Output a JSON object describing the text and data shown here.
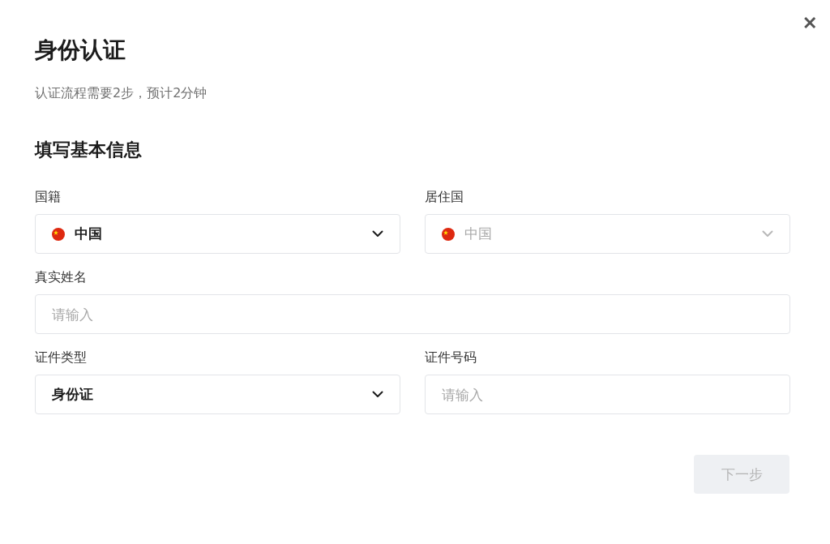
{
  "dialog": {
    "title": "身份认证",
    "close": "✕",
    "subtitle": "认证流程需要2步，预计2分钟"
  },
  "section": {
    "title": "填写基本信息"
  },
  "rows": [
    [
      {
        "kind": "select",
        "label": "国籍",
        "value": "中国",
        "flag": true,
        "disabled": false
      },
      {
        "kind": "select",
        "label": "居住国",
        "value": "中国",
        "flag": true,
        "disabled": true
      }
    ],
    [
      {
        "kind": "input",
        "label": "真实姓名",
        "placeholder": "请输入"
      }
    ],
    [
      {
        "kind": "select",
        "label": "证件类型",
        "value": "身份证",
        "flag": false,
        "disabled": false
      },
      {
        "kind": "input",
        "label": "证件号码",
        "placeholder": "请输入"
      }
    ]
  ],
  "next_button": {
    "label": "下一步",
    "disabled": true
  }
}
